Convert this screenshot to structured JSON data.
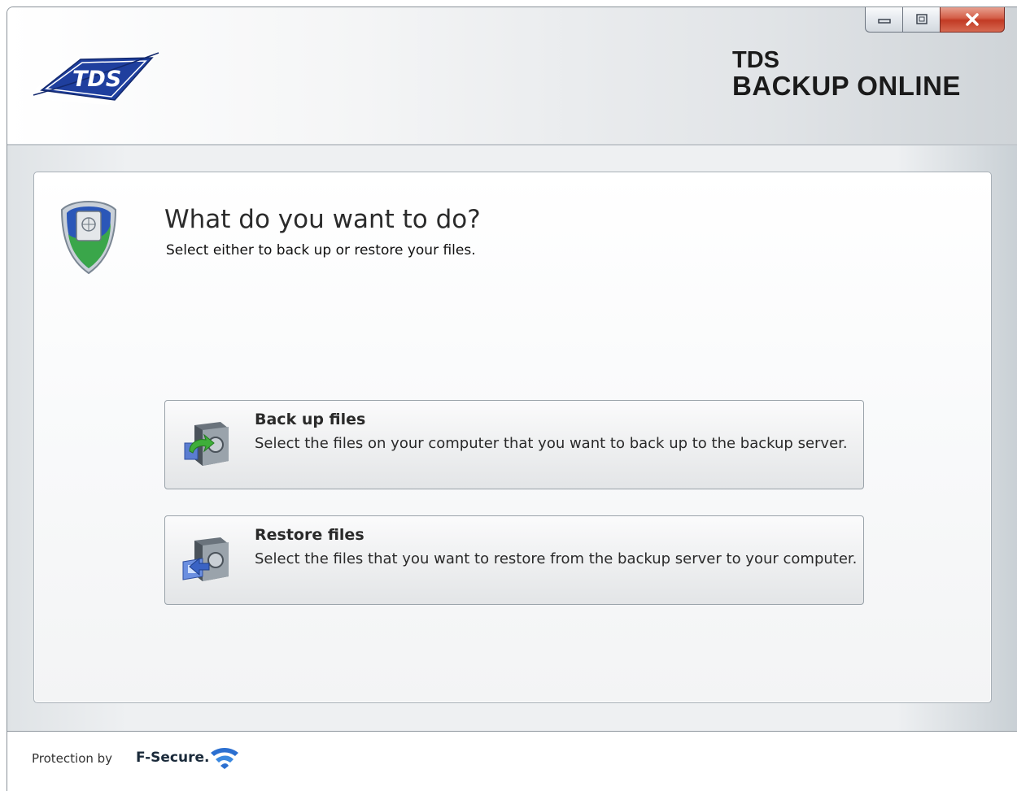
{
  "header": {
    "brand_logo_text": "TDS",
    "product_line1": "TDS",
    "product_line2": "BACKUP ONLINE"
  },
  "window_controls": {
    "icons": [
      "minimize-icon",
      "maximize-icon",
      "close-icon"
    ]
  },
  "main": {
    "heading": "What do you want to do?",
    "subheading": "Select either to back up or restore your files.",
    "options": [
      {
        "title": "Back up files",
        "description": "Select the files on your computer that you want to back up to the backup server.",
        "icon": "backup-safe-icon"
      },
      {
        "title": "Restore files",
        "description": "Select the files that you want to restore from the backup server to your computer.",
        "icon": "restore-safe-icon"
      }
    ]
  },
  "footer": {
    "prefix": "Protection by",
    "brand": "F-Secure."
  },
  "colors": {
    "logo_blue": "#1f3f9e",
    "close_red": "#c8412b",
    "text_dark": "#2a2a2a"
  }
}
